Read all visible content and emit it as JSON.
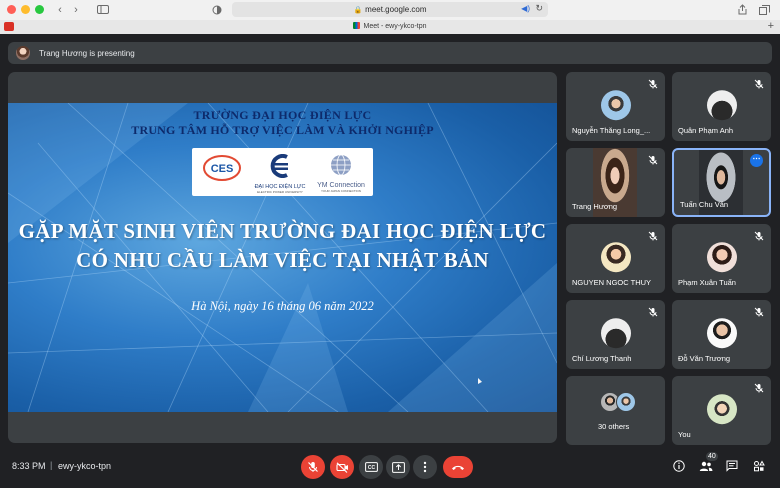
{
  "browser": {
    "url": "meet.google.com",
    "tab_title": "Meet - ewy-ykco-tpn"
  },
  "presenting": {
    "text": "Trang Hương is presenting"
  },
  "slide": {
    "header_line1": "TRƯỜNG ĐẠI HỌC ĐIỆN LỰC",
    "header_line2": "TRUNG TÂM HỖ TRỢ VIỆC LÀM VÀ KHỞI NGHIỆP",
    "logos": [
      {
        "text": "CES"
      },
      {
        "text": "ĐẠI HỌC ĐIỆN LỰC",
        "sub": "ELECTRIC POWER UNIVERSITY"
      },
      {
        "text": "YM Connection",
        "sub": "YOUR JAPAN CONNECTION"
      }
    ],
    "title_line1": "GẶP MẶT SINH VIÊN TRƯỜNG ĐẠI HỌC ĐIỆN LỰC",
    "title_line2": "CÓ NHU CẦU LÀM VIỆC TẠI NHẬT BẢN",
    "date_line": "Hà Nội, ngày 16 tháng 06 năm 2022"
  },
  "participants": [
    {
      "name": "Nguyễn Thăng Long_...",
      "muted": true,
      "avatar": "av-sky"
    },
    {
      "name": "Quân Phạm Anh",
      "muted": true,
      "avatar": "av-dark"
    },
    {
      "name": "Trang Hương",
      "muted": true,
      "video": "trang"
    },
    {
      "name": "Tuấn Chu Văn",
      "muted": false,
      "video": "tuan",
      "active": true
    },
    {
      "name": "NGUYEN NGOC THUY",
      "muted": true,
      "avatar": "av-yellow"
    },
    {
      "name": "Phạm Xuân Tuấn",
      "muted": true,
      "avatar": "av-pink"
    },
    {
      "name": "Chí Lương Thanh",
      "muted": true,
      "avatar": "av-dark"
    },
    {
      "name": "Đỗ Văn Trương",
      "muted": true,
      "avatar": "av-white"
    },
    {
      "name": "30 others",
      "muted": false,
      "others": true
    },
    {
      "name": "You",
      "muted": true,
      "avatar": "av-you"
    }
  ],
  "bottom_bar": {
    "time": "8:33 PM",
    "separator": "|",
    "meeting_code": "ewy-ykco-tpn",
    "people_count": "40"
  },
  "colors": {
    "background": "#202124",
    "tile": "#3c4043",
    "danger": "#ea4335",
    "active_border": "#8ab4f8"
  }
}
